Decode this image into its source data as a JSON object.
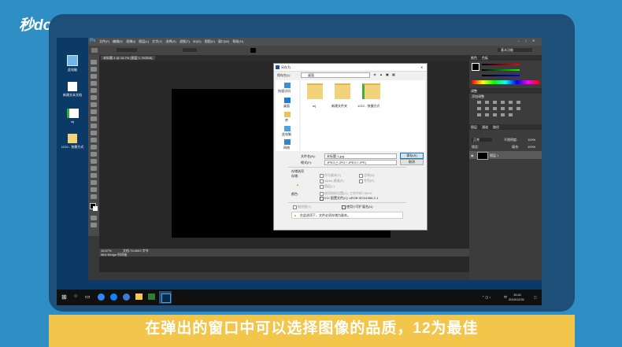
{
  "watermark": {
    "logo_text": "秒dong视频"
  },
  "caption": {
    "text": "在弹出的窗口中可以选择图像的品质，12为最佳"
  },
  "desktop": {
    "icons": [
      {
        "label": "此电脑",
        "icon": "computer-icon"
      },
      {
        "label": "新建文本文档",
        "icon": "text-file-icon"
      },
      {
        "label": "wj",
        "icon": "file-icon"
      },
      {
        "label": "1210 - 快捷方式",
        "icon": "shortcut-icon"
      }
    ]
  },
  "photoshop": {
    "logo": "Ps",
    "menu": [
      "文件(F)",
      "编辑(E)",
      "图像(I)",
      "图层(L)",
      "文字(Y)",
      "选择(S)",
      "滤镜(T)",
      "3D(D)",
      "视图(V)",
      "窗口(W)",
      "帮助(H)"
    ],
    "document_tab": "未标题-1 @ 16.7% (图层 1, RGB/8)",
    "workspace": "基本功能",
    "zoom": "16.67%",
    "status_doc": "文档:76.6M/0 字节",
    "status_bottom": "Mini Bridge   时间轴",
    "panels": {
      "color_tab": "颜色",
      "swatches_tab": "色板",
      "adjust_tab": "调整",
      "adjust_title": "添加调整",
      "layers_tab": "图层",
      "channels_tab": "通道",
      "paths_tab": "路径",
      "blend_mode": "正常",
      "opacity_label": "不透明度:",
      "opacity": "100%",
      "fill_label": "填充:",
      "fill": "100%",
      "lock_label": "锁定:",
      "layer_name": "图层 1"
    }
  },
  "save_dialog": {
    "title": "另存为",
    "save_in_label": "保存在(I):",
    "location": "桌面",
    "nav": [
      "快速访问",
      "桌面",
      "库",
      "此电脑",
      "网络"
    ],
    "files": [
      "wj",
      "新建文件夹",
      "1210 - 快捷方式"
    ],
    "filename_label": "文件名(N):",
    "filename": "未标题-1.jpg",
    "format_label": "格式(F):",
    "format": "JPEG (*.JPG;*.JPEG;*.JPE)",
    "save_button": "保存(S)",
    "cancel_button": "取消",
    "options_title": "存储选项",
    "store_label": "存储:",
    "as_copy": "作为副本(Y)",
    "notes": "注释(N)",
    "alpha": "Alpha 通道(E)",
    "spot": "专色(P)",
    "layers": "图层(L)",
    "color_label": "颜色:",
    "proof": "使用校样设置(O): 工作中的 CMYK",
    "icc": "ICC 配置文件(C): sRGB IEC61966-2.1",
    "thumbnail": "缩览图(T)",
    "lowercase_ext": "使用小写扩展名(U)",
    "warning": "在此选项下，文件必须存储为副本。"
  },
  "taskbar": {
    "time": "15:41",
    "date": "2019/12/31",
    "lang": "中"
  }
}
